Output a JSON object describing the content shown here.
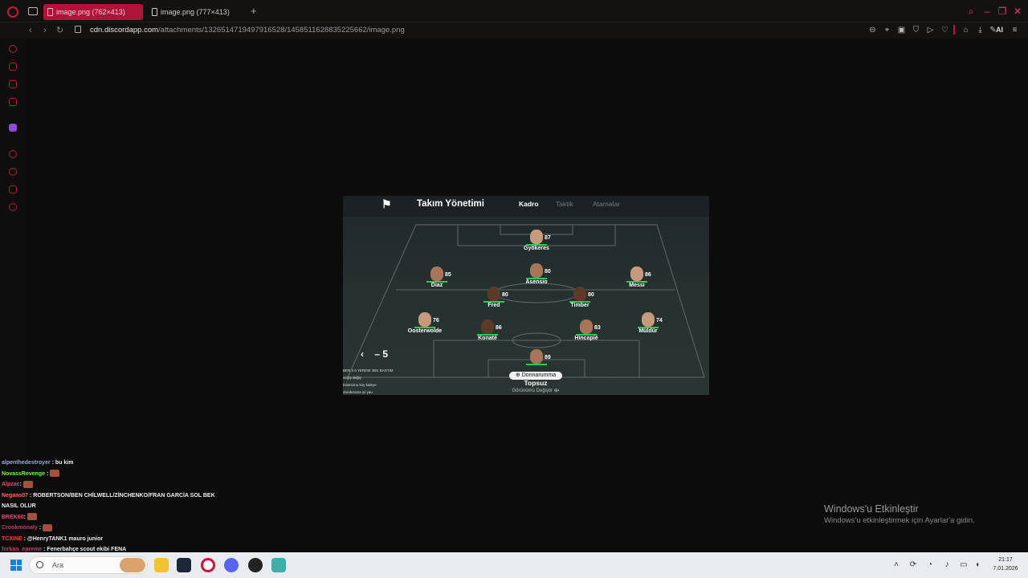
{
  "browser": {
    "tabs": [
      {
        "label": "image.png (762×413)",
        "active": true
      },
      {
        "label": "image.png (777×413)",
        "active": false
      }
    ],
    "new_tab": "+",
    "url_host": "cdn.discordapp.com",
    "url_path": "/attachments/1326514719497916528/1458511628835225662/image.png",
    "ai_label": "AI",
    "accent_color": "#b0133a"
  },
  "game": {
    "title": "Takım Yönetimi",
    "tabs": [
      "Kadro",
      "Taktik",
      "Atamalar"
    ],
    "back_label": "‹",
    "page_indicator": "– 5",
    "players": [
      {
        "name": "Gyökeres",
        "rating": "87"
      },
      {
        "name": "Diaz",
        "rating": "85"
      },
      {
        "name": "Asensio",
        "rating": "80"
      },
      {
        "name": "Messi",
        "rating": "86"
      },
      {
        "name": "Fred",
        "rating": "80"
      },
      {
        "name": "Timber",
        "rating": "80"
      },
      {
        "name": "Oosterwolde",
        "rating": "76"
      },
      {
        "name": "Konaté",
        "rating": "86"
      },
      {
        "name": "Hincapié",
        "rating": "83"
      },
      {
        "name": "Müldür",
        "rating": "74"
      },
      {
        "name": "Donnarumma",
        "rating": "89"
      }
    ],
    "formation_name": "Topsuz",
    "formation_sub": "Görünümü Değiştir ⟴",
    "overlay_chat": [
      "BEN 3 6 YERINE 3EK BASTIM",
      "değiş değiş",
      "Edersonu koy kaleye",
      "donduruma iyi yau"
    ]
  },
  "chat": [
    {
      "user": "alpenthedestroyer",
      "text": ": bu kim"
    },
    {
      "user": "NovassRevenge",
      "text": ":"
    },
    {
      "user": "Alpzac",
      "text": ":"
    },
    {
      "user": "Negans07",
      "text": ": ROBERTSON/BEN CHİLWELL/ZİNCHENKO/FRAN GARCİA SOL BEK"
    },
    {
      "user": "",
      "text": "NASIL OLUR"
    },
    {
      "user": "BREK60",
      "text": ":"
    },
    {
      "user": "Crookmonaly",
      "text": ":"
    },
    {
      "user": "TCXINE",
      "text": ": @HenryTANK1 mauro junior"
    },
    {
      "user": "forkan_epreme",
      "text": ": Fenerbahçe scout ekibi FENA"
    }
  ],
  "activation": {
    "title": "Windows'u Etkinleştir",
    "subtitle": "Windows'u etkinleştirmek için Ayarlar'a gidin."
  },
  "taskbar": {
    "search_placeholder": "Ara",
    "time": "21:17",
    "date": "7.01.2026"
  }
}
